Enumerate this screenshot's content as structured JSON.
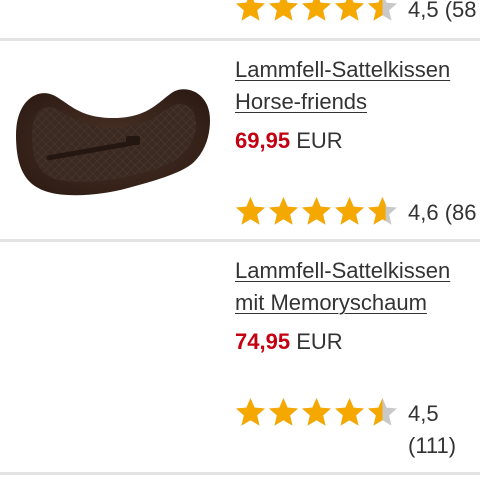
{
  "colors": {
    "price": "#c40012",
    "star_fill": "#f5a800",
    "star_empty": "#c9c9c9",
    "text": "#333333",
    "divider": "#e4e4e4"
  },
  "products": [
    {
      "rating_value": "4,5",
      "rating_count": "(58",
      "stars": 4.5
    },
    {
      "title_line1": "Lammfell-Sattelkissen",
      "title_line2": "Horse-friends",
      "price": "69,95",
      "currency": "EUR",
      "rating_value": "4,6",
      "rating_count": "(86",
      "stars": 4.6,
      "image": "brown-lambskin-saddle-pad"
    },
    {
      "title_line1": "Lammfell-Sattelkissen",
      "title_line2": "mit Memoryschaum",
      "price": "74,95",
      "currency": "EUR",
      "rating_value": "4,5",
      "rating_count": "(111)",
      "stars": 4.5
    }
  ]
}
